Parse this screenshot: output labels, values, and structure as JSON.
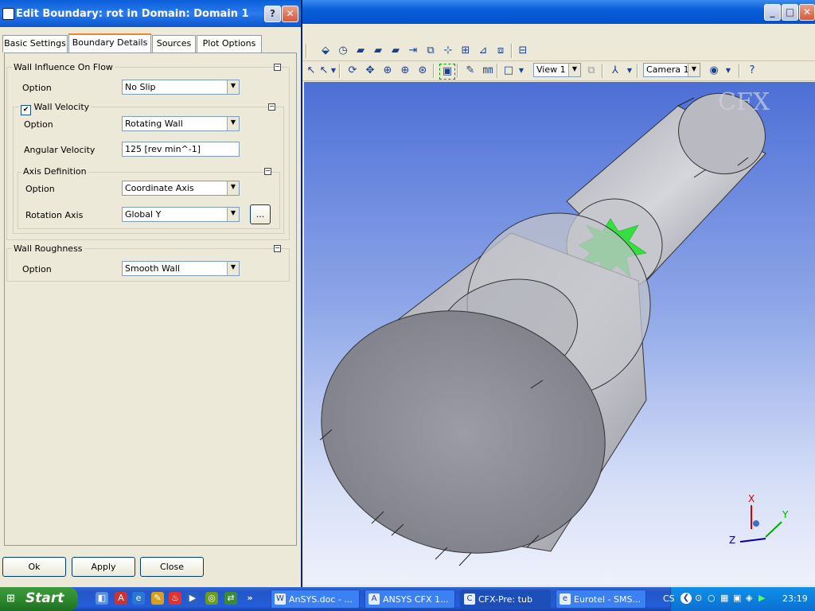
{
  "dialog": {
    "title": "Edit Boundary: rot in Domain: Domain 1",
    "help_label": "?",
    "close_label": "✕",
    "tabs": [
      "Basic Settings",
      "Boundary Details",
      "Sources",
      "Plot Options"
    ],
    "wall_influence": {
      "title": "Wall Influence On Flow",
      "option_label": "Option",
      "option_value": "No Slip"
    },
    "wall_velocity": {
      "title": "Wall Velocity",
      "checked": true,
      "option_label": "Option",
      "option_value": "Rotating Wall",
      "angular_label": "Angular Velocity",
      "angular_value": "125 [rev min^-1]"
    },
    "axis_definition": {
      "title": "Axis Definition",
      "option_label": "Option",
      "option_value": "Coordinate Axis",
      "rotation_label": "Rotation Axis",
      "rotation_value": "Global Y",
      "browse_label": "..."
    },
    "wall_roughness": {
      "title": "Wall Roughness",
      "option_label": "Option",
      "option_value": "Smooth Wall"
    },
    "buttons": {
      "ok": "Ok",
      "apply": "Apply",
      "close": "Close"
    }
  },
  "viewer": {
    "view_select": "View 1",
    "camera_select": "Camera 1",
    "watermark": "CFX",
    "axes": {
      "x": "X",
      "y": "Y",
      "z": "Z"
    },
    "highlight_color": "#33e040",
    "background_top": "#4d6fd6",
    "background_bottom": "#eef1fb"
  },
  "taskbar": {
    "start_label": "Start",
    "more_label": "»",
    "tasks": [
      {
        "label": "AnSYS.doc - ...",
        "icon": "W"
      },
      {
        "label": "ANSYS CFX 1...",
        "icon": "A"
      },
      {
        "label": "CFX-Pre:  tub",
        "icon": "C"
      },
      {
        "label": "Eurotel - SMS...",
        "icon": "e"
      }
    ],
    "lang": "CS",
    "clock": "23:19"
  }
}
